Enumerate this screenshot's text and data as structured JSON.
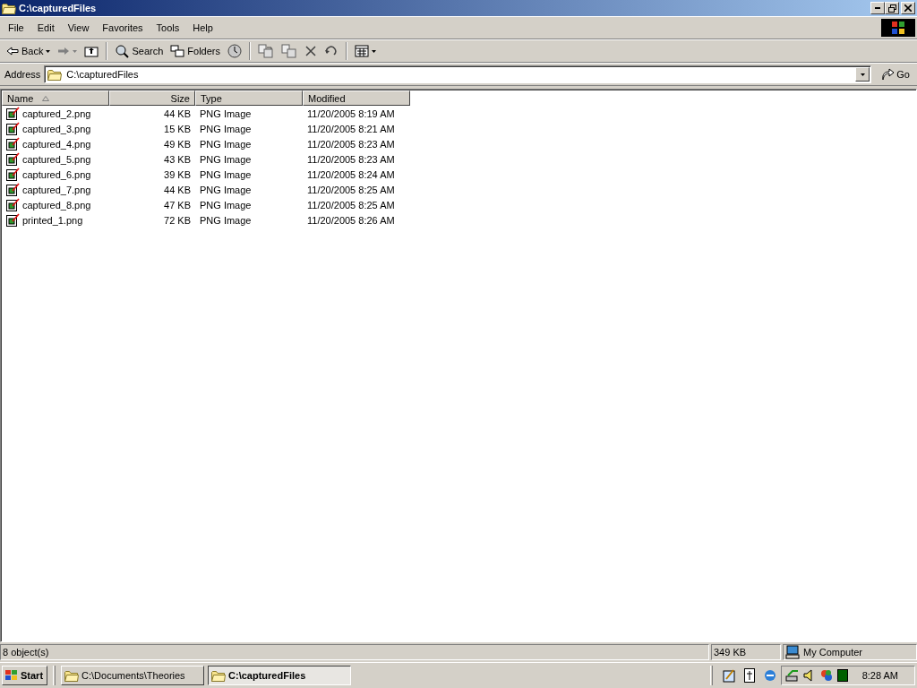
{
  "window": {
    "title": "C:\\capturedFiles"
  },
  "menu": [
    "File",
    "Edit",
    "View",
    "Favorites",
    "Tools",
    "Help"
  ],
  "toolbar": [
    {
      "kind": "back",
      "label": "Back",
      "disabled": false
    },
    {
      "kind": "forward",
      "disabled": true
    },
    {
      "kind": "up"
    },
    {
      "kind": "separator"
    },
    {
      "kind": "search",
      "label": "Search",
      "disabled": false
    },
    {
      "kind": "folders",
      "label": "Folders",
      "disabled": false
    },
    {
      "kind": "history"
    },
    {
      "kind": "separator"
    },
    {
      "kind": "move"
    },
    {
      "kind": "copy"
    },
    {
      "kind": "delete"
    },
    {
      "kind": "undo"
    },
    {
      "kind": "separator"
    },
    {
      "kind": "views"
    }
  ],
  "address": {
    "label": "Address",
    "value": "C:\\capturedFiles",
    "go": "Go"
  },
  "columns": [
    {
      "label": "Name",
      "sorted": true
    },
    {
      "label": "Size",
      "sorted": false
    },
    {
      "label": "Type",
      "sorted": false
    },
    {
      "label": "Modified",
      "sorted": false
    }
  ],
  "rows": [
    {
      "name": "captured_2.png",
      "size": "44 KB",
      "type": "PNG Image",
      "modified": "11/20/2005 8:19 AM"
    },
    {
      "name": "captured_3.png",
      "size": "15 KB",
      "type": "PNG Image",
      "modified": "11/20/2005 8:21 AM"
    },
    {
      "name": "captured_4.png",
      "size": "49 KB",
      "type": "PNG Image",
      "modified": "11/20/2005 8:23 AM"
    },
    {
      "name": "captured_5.png",
      "size": "43 KB",
      "type": "PNG Image",
      "modified": "11/20/2005 8:23 AM"
    },
    {
      "name": "captured_6.png",
      "size": "39 KB",
      "type": "PNG Image",
      "modified": "11/20/2005 8:24 AM"
    },
    {
      "name": "captured_7.png",
      "size": "44 KB",
      "type": "PNG Image",
      "modified": "11/20/2005 8:25 AM"
    },
    {
      "name": "captured_8.png",
      "size": "47 KB",
      "type": "PNG Image",
      "modified": "11/20/2005 8:25 AM"
    },
    {
      "name": "printed_1.png",
      "size": "72 KB",
      "type": "PNG Image",
      "modified": "11/20/2005 8:26 AM"
    }
  ],
  "status_bar": {
    "objects": "8 object(s)",
    "size": "349 KB",
    "zone": "My Computer"
  },
  "taskbar": {
    "start": "Start",
    "tasks": [
      {
        "label": "C:\\Documents\\Theories",
        "selected": false
      },
      {
        "label": "C:\\capturedFiles",
        "selected": true
      }
    ],
    "clock": "8:28 AM"
  }
}
